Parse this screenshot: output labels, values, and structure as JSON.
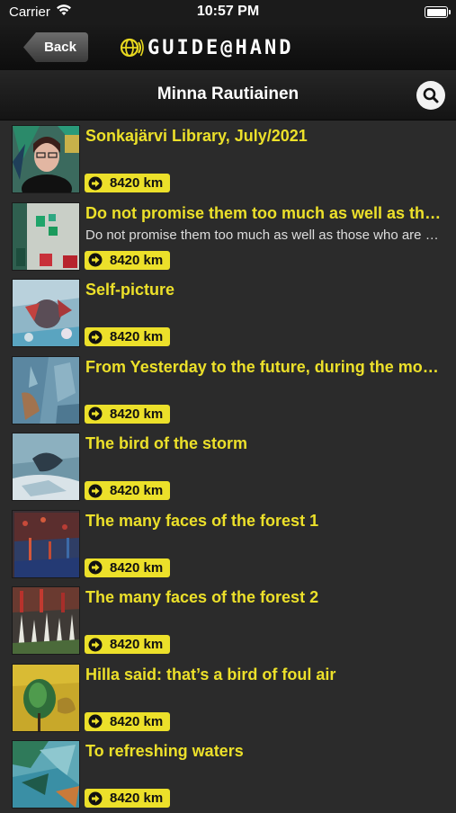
{
  "status": {
    "carrier": "Carrier",
    "time": "10:57 PM",
    "battery_level": 1.0
  },
  "nav": {
    "back_label": "Back",
    "logo_text": "GUIDE@HAND"
  },
  "header": {
    "title": "Minna Rautiainen"
  },
  "items": [
    {
      "title": "Sonkajärvi Library, July/2021",
      "subtitle": "",
      "distance": "8420 km"
    },
    {
      "title": "Do not promise them too much as well as those who are much more",
      "subtitle": "Do not promise them too much as well as those who are much more",
      "distance": "8420 km"
    },
    {
      "title": "Self-picture",
      "subtitle": "",
      "distance": "8420 km"
    },
    {
      "title": "From Yesterday to the future, during the moment",
      "subtitle": "",
      "distance": "8420 km"
    },
    {
      "title": "The bird of the storm",
      "subtitle": "",
      "distance": "8420 km"
    },
    {
      "title": "The many faces of the forest 1",
      "subtitle": "",
      "distance": "8420 km"
    },
    {
      "title": "The many faces of the forest 2",
      "subtitle": "",
      "distance": "8420 km"
    },
    {
      "title": "Hilla said: that’s a bird of foul air",
      "subtitle": "",
      "distance": "8420 km"
    },
    {
      "title": "To refreshing waters",
      "subtitle": "",
      "distance": "8420 km"
    }
  ],
  "colors": {
    "accent": "#ece02a",
    "background": "#2b2b2b",
    "bar": "#141414"
  }
}
